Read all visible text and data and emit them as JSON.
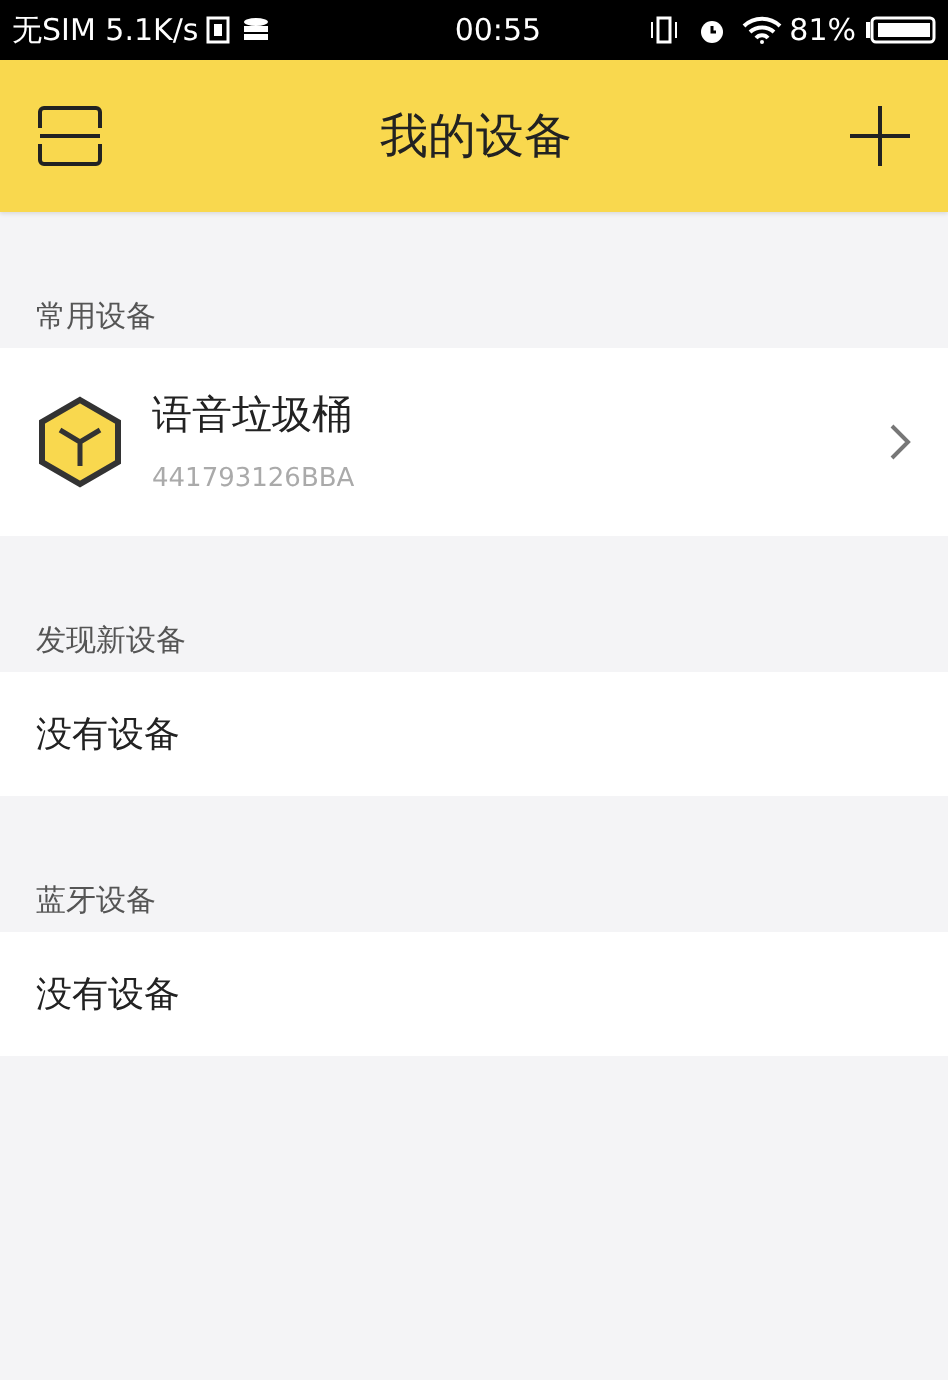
{
  "status_bar": {
    "carrier": "无SIM 5.1K/s",
    "time": "00:55",
    "battery": "81%"
  },
  "header": {
    "title": "我的设备"
  },
  "sections": [
    {
      "title": "常用设备",
      "items": [
        {
          "kind": "device",
          "name": "语音垃圾桶",
          "id": "441793126BBA"
        }
      ]
    },
    {
      "title": "发现新设备",
      "items": [
        {
          "kind": "empty",
          "name": "没有设备"
        }
      ]
    },
    {
      "title": "蓝牙设备",
      "items": [
        {
          "kind": "empty",
          "name": "没有设备"
        }
      ]
    }
  ]
}
